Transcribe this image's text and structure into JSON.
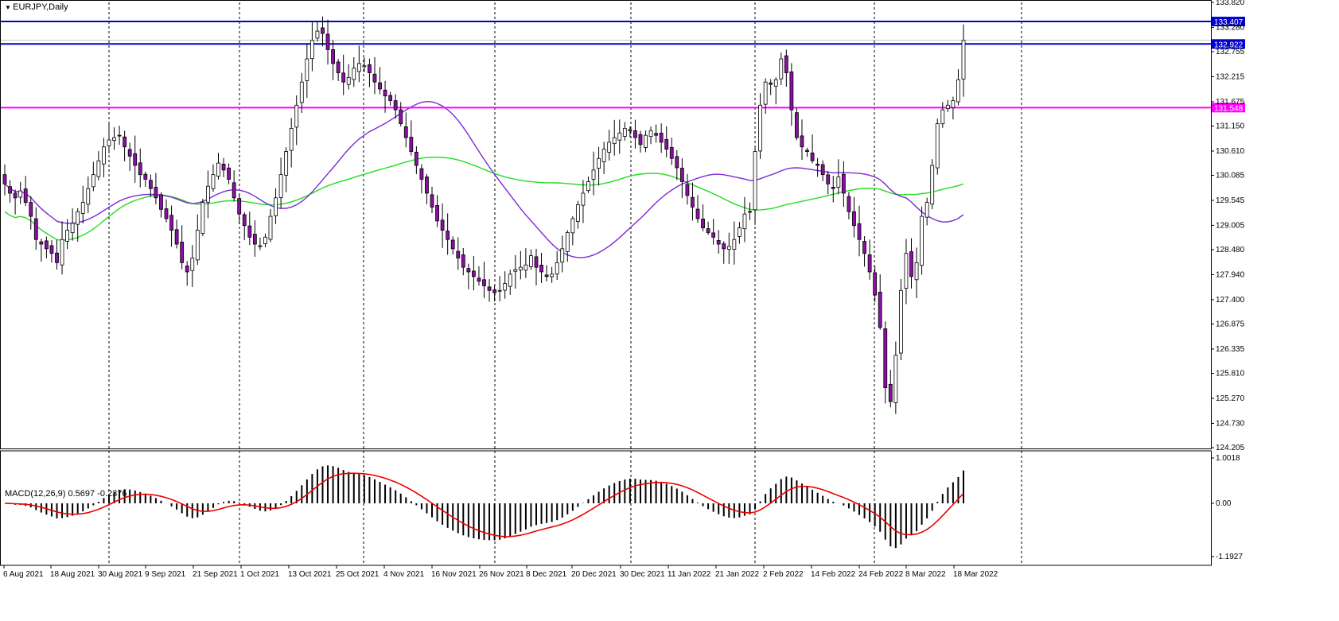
{
  "header": {
    "symbol_label": "EURJPY,Daily",
    "macd_label": "MACD(12,26,9) 0.5697 -0.2376"
  },
  "colors": {
    "background": "#ffffff",
    "bull_body": "#ffffff",
    "bear_body": "#8b0fa6",
    "candle_outline": "#000000",
    "resistance_line": "#0000cc",
    "support_line": "#ff00ff",
    "ma_fast": "#7b2bd6",
    "ma_slow": "#22dd22",
    "macd_signal": "#ee0000",
    "macd_hist": "#000000",
    "grid": "#000000"
  },
  "chart_data": [
    {
      "type": "candlestick",
      "symbol": "EURJPY",
      "timeframe": "Daily",
      "ylim": [
        124.205,
        133.82
      ],
      "y_ticks": [
        133.82,
        133.28,
        132.755,
        132.215,
        131.675,
        131.15,
        130.61,
        130.085,
        129.545,
        129.005,
        128.48,
        127.94,
        127.4,
        126.875,
        126.335,
        125.81,
        125.27,
        124.73,
        124.205
      ],
      "y_tick_labels": [
        "133.820",
        "133.280",
        "132.755",
        "132.215",
        "131.675",
        "131.150",
        "130.610",
        "130.085",
        "129.545",
        "129.005",
        "128.480",
        "127.940",
        "127.400",
        "126.875",
        "126.335",
        "125.810",
        "125.270",
        "124.730",
        "124.205"
      ],
      "x_labels": [
        "6 Aug 2021",
        "18 Aug 2021",
        "30 Aug 2021",
        "9 Sep 2021",
        "21 Sep 2021",
        "1 Oct 2021",
        "13 Oct 2021",
        "25 Oct 2021",
        "4 Nov 2021",
        "16 Nov 2021",
        "26 Nov 2021",
        "8 Dec 2021",
        "20 Dec 2021",
        "30 Dec 2021",
        "11 Jan 2022",
        "21 Jan 2022",
        "2 Feb 2022",
        "14 Feb 2022",
        "24 Feb 2022",
        "8 Mar 2022",
        "18 Mar 2022"
      ],
      "horizontal_levels": [
        {
          "price": 133.407,
          "label": "133.407",
          "color": "#0000cc"
        },
        {
          "price": 132.922,
          "label": "132.922",
          "color": "#0000cc"
        },
        {
          "price": 131.548,
          "label": "131.548",
          "color": "#ff00ff"
        }
      ],
      "close_segments": [
        {
          "bars": 28,
          "close": [
            129.9,
            129.7,
            129.6,
            129.75,
            129.5,
            129.2,
            128.7,
            128.6,
            128.5,
            128.4,
            128.2,
            128.7,
            128.9,
            129.05,
            129.3,
            129.5,
            129.8,
            130.1,
            130.4,
            130.7,
            130.85,
            130.9,
            130.95,
            130.7,
            130.5,
            130.3,
            130.1,
            130.0
          ]
        },
        {
          "bars": 24,
          "close": [
            129.8,
            129.6,
            129.35,
            129.15,
            128.9,
            128.6,
            128.2,
            128.0,
            128.3,
            128.9,
            129.5,
            129.85,
            130.1,
            130.35,
            130.2,
            130.0,
            129.6,
            129.25,
            129.0,
            128.75,
            128.6,
            128.55,
            128.75,
            129.2
          ]
        },
        {
          "bars": 24,
          "close": [
            129.6,
            130.1,
            130.6,
            131.1,
            131.6,
            132.1,
            132.6,
            133.0,
            133.2,
            133.15,
            132.8,
            132.5,
            132.3,
            132.1,
            132.2,
            132.4,
            132.5,
            132.45,
            132.3,
            132.1,
            131.95,
            131.8,
            131.7,
            131.5
          ]
        },
        {
          "bars": 25,
          "close": [
            131.2,
            130.9,
            130.6,
            130.3,
            130.0,
            129.7,
            129.4,
            129.1,
            128.9,
            128.7,
            128.5,
            128.3,
            128.1,
            128.0,
            127.9,
            127.8,
            127.7,
            127.6,
            127.55,
            127.6,
            127.75,
            127.95,
            128.05,
            128.1,
            128.15
          ]
        },
        {
          "bars": 22,
          "close": [
            128.35,
            128.1,
            128.0,
            127.9,
            127.95,
            128.2,
            128.5,
            128.85,
            129.15,
            129.45,
            129.7,
            129.95,
            130.2,
            130.45,
            130.65,
            130.8,
            130.9,
            131.0,
            131.1,
            131.05,
            130.9,
            130.75
          ]
        },
        {
          "bars": 20,
          "close": [
            130.95,
            131.05,
            130.95,
            130.8,
            130.65,
            130.45,
            130.25,
            129.95,
            129.65,
            129.4,
            129.15,
            128.95,
            128.85,
            128.75,
            128.6,
            128.5,
            128.55,
            128.7,
            128.95,
            129.25
          ]
        },
        {
          "bars": 24,
          "close": [
            129.3,
            130.6,
            131.6,
            132.1,
            132.05,
            132.15,
            132.6,
            132.3,
            131.5,
            130.9,
            130.7,
            130.6,
            130.4,
            130.3,
            130.1,
            129.9,
            129.8,
            130.05,
            129.7,
            129.3,
            129.0,
            128.7,
            128.4,
            128.0
          ]
        },
        {
          "bars": 10,
          "close": [
            127.5,
            126.8,
            125.5,
            125.2,
            126.2,
            127.6,
            128.4,
            127.9,
            128.2,
            129.2
          ]
        },
        {
          "bars": 8,
          "close": [
            129.5,
            130.3,
            131.2,
            131.5,
            131.6,
            131.7,
            132.15,
            133.0
          ]
        }
      ]
    },
    {
      "type": "macd",
      "params": [
        12,
        26,
        9
      ],
      "macd_value": 0.5697,
      "signal_value": -0.2376,
      "ylim": [
        -1.1927,
        1.0018
      ],
      "y_ticks": [
        1.0018,
        0.0,
        -1.1927
      ],
      "y_tick_labels": [
        "1.0018",
        "0.00",
        "-1.1927"
      ]
    }
  ]
}
